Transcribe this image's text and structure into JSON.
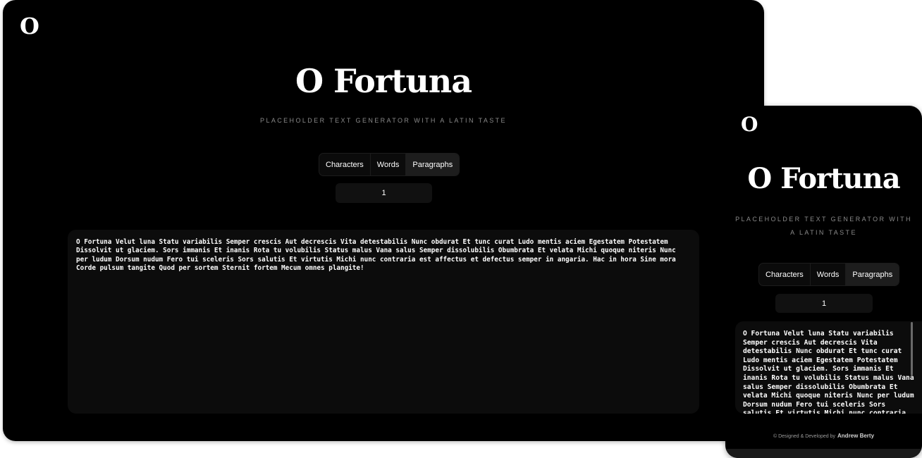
{
  "app": {
    "logo": "O",
    "title": "O Fortuna",
    "subtitle": "PLACEHOLDER TEXT GENERATOR WITH A LATIN TASTE"
  },
  "tabs": [
    "Characters",
    "Words",
    "Paragraphs"
  ],
  "active_tab": "Paragraphs",
  "count": "1",
  "output_text": "O Fortuna Velut luna Statu variabilis Semper crescis Aut decrescis Vita detestabilis Nunc obdurat Et tunc curat Ludo mentis aciem Egestatem Potestatem Dissolvit ut glaciem. Sors immanis Et inanis Rota tu volubilis Status malus Vana salus Semper dissolubilis Obumbrata Et velata Michi quoque niteris Nunc per ludum Dorsum nudum Fero tui sceleris Sors salutis Et virtutis Michi nunc contraria est affectus et defectus semper in angaria. Hac in hora Sine mora Corde pulsum tangite Quod per sortem Sternit fortem Mecum omnes plangite!",
  "footer": {
    "copyright": "© Designed & Developed by",
    "author": "Andrew Berty"
  },
  "colors": {
    "background": "#000000",
    "page": "#ffffff",
    "active_tab": "#1d1d1d",
    "subtitle": "#8a8a8a"
  }
}
